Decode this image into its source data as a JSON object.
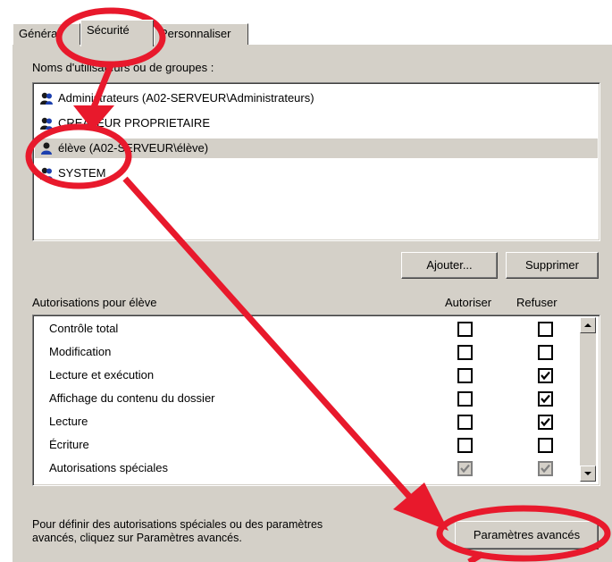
{
  "tabs": [
    {
      "label": "Général"
    },
    {
      "label": "Sécurité"
    },
    {
      "label": "Personnaliser"
    }
  ],
  "users_section": {
    "label": "Noms d'utilisateurs ou de groupes :",
    "users": [
      {
        "name": "Administrateurs (A02-SERVEUR\\Administrateurs)",
        "icon": "group-icon"
      },
      {
        "name": "CREATEUR PROPRIETAIRE",
        "icon": "group-icon"
      },
      {
        "name": "élève (A02-SERVEUR\\élève)",
        "icon": "user-icon",
        "selected": true
      },
      {
        "name": "SYSTEM",
        "icon": "group-icon"
      }
    ],
    "add_button": "Ajouter...",
    "remove_button": "Supprimer"
  },
  "permissions_section": {
    "label": "Autorisations pour élève",
    "col_allow": "Autoriser",
    "col_deny": "Refuser",
    "rows": [
      {
        "name": "Contrôle total",
        "allow": false,
        "deny": false,
        "disabled": false
      },
      {
        "name": "Modification",
        "allow": false,
        "deny": false,
        "disabled": false
      },
      {
        "name": "Lecture et exécution",
        "allow": false,
        "deny": true,
        "disabled": false
      },
      {
        "name": "Affichage du contenu du dossier",
        "allow": false,
        "deny": true,
        "disabled": false
      },
      {
        "name": "Lecture",
        "allow": false,
        "deny": true,
        "disabled": false
      },
      {
        "name": "Écriture",
        "allow": false,
        "deny": false,
        "disabled": false
      },
      {
        "name": "Autorisations spéciales",
        "allow": true,
        "deny": true,
        "disabled": true
      }
    ]
  },
  "footer": {
    "text_line1": "Pour définir des autorisations spéciales ou des paramètres",
    "text_line2": "avancés, cliquez sur Paramètres avancés.",
    "advanced_button": "Paramètres avancés"
  },
  "annotation_color": "#e8192c"
}
